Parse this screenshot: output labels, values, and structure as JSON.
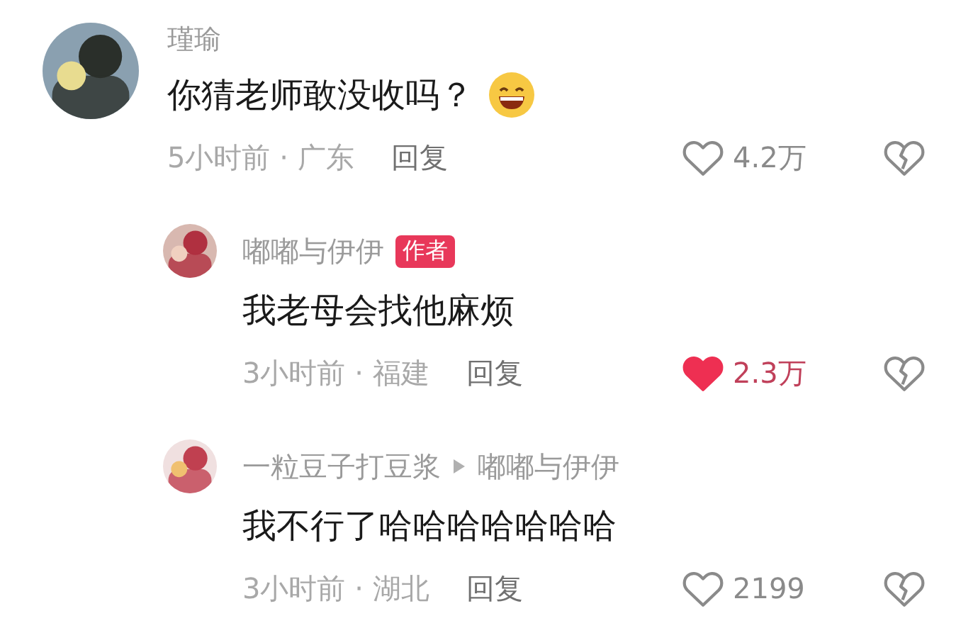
{
  "comments": [
    {
      "user": "瑾瑜",
      "text": "你猜老师敢没收吗？",
      "emoji": true,
      "time_location": "5小时前 · 广东",
      "reply_label": "回复",
      "likes": "4.2万",
      "liked": false,
      "replies": [
        {
          "user": "嘟嘟与伊伊",
          "badge": "作者",
          "text": "我老母会找他麻烦",
          "time_location": "3小时前 · 福建",
          "reply_label": "回复",
          "likes": "2.3万",
          "liked": true
        },
        {
          "user": "一粒豆子打豆浆",
          "reply_to": "嘟嘟与伊伊",
          "text": "我不行了哈哈哈哈哈哈哈",
          "time_location": "3小时前 · 湖北",
          "reply_label": "回复",
          "likes": "2199",
          "liked": false
        }
      ]
    }
  ]
}
